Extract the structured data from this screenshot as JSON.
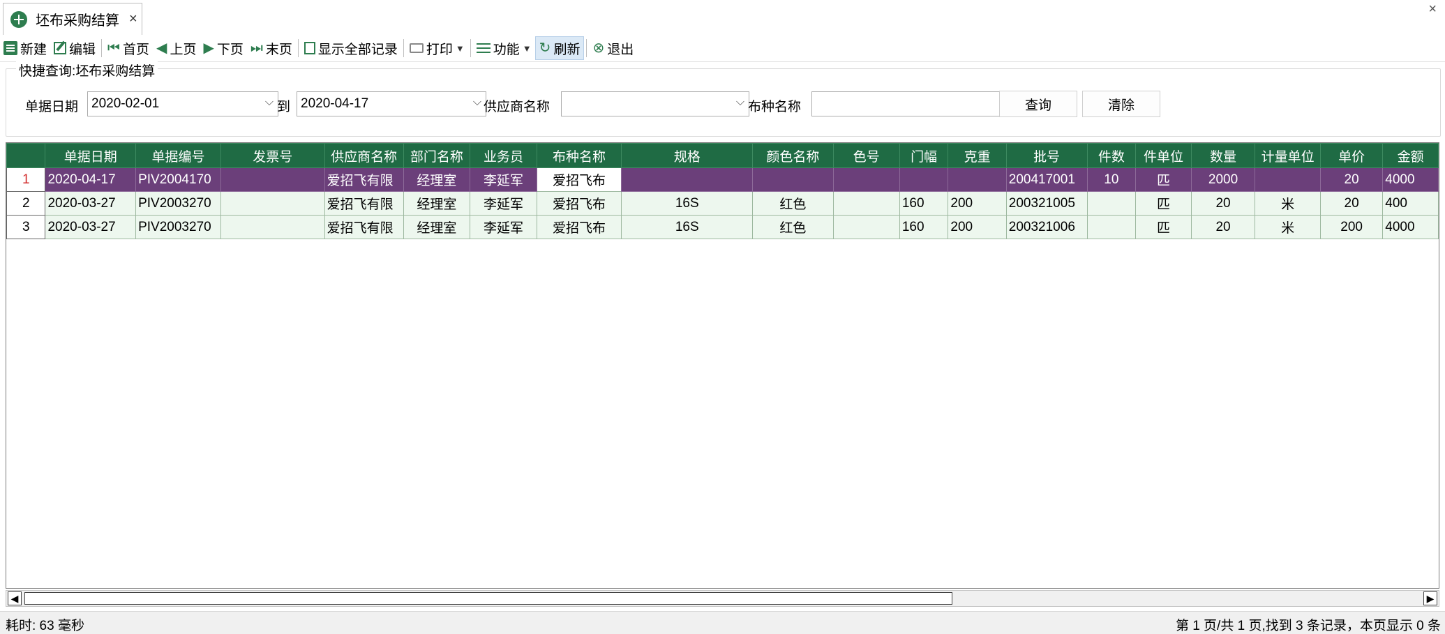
{
  "tab": {
    "title": "坯布采购结算",
    "close": "×"
  },
  "window": {
    "close": "×"
  },
  "toolbar": {
    "new": "新建",
    "edit": "编辑",
    "first": "首页",
    "prev": "上页",
    "next": "下页",
    "last": "末页",
    "show_all": "显示全部记录",
    "print": "打印",
    "function": "功能",
    "refresh": "刷新",
    "exit": "退出"
  },
  "query": {
    "title": "快捷查询:坯布采购结算",
    "date_label": "单据日期",
    "date_from": "2020-02-01",
    "to_label": "到",
    "date_to": "2020-04-17",
    "supplier_label": "供应商名称",
    "supplier_value": "",
    "fabric_label": "布种名称",
    "fabric_value": "",
    "search_button": "查询",
    "clear_button": "清除"
  },
  "grid": {
    "columns": [
      "",
      "单据日期",
      "单据编号",
      "发票号",
      "供应商名称",
      "部门名称",
      "业务员",
      "布种名称",
      "规格",
      "颜色名称",
      "色号",
      "门幅",
      "克重",
      "批号",
      "件数",
      "件单位",
      "数量",
      "计量单位",
      "单价",
      "金额"
    ],
    "rows": [
      [
        "1",
        "2020-04-17",
        "PIV2004170",
        "",
        "爱招飞有限",
        "经理室",
        "李延军",
        "爱招飞布",
        "",
        "",
        "",
        "",
        "",
        "200417001",
        "10",
        "匹",
        "2000",
        "",
        "20",
        "4000"
      ],
      [
        "2",
        "2020-03-27",
        "PIV2003270",
        "",
        "爱招飞有限",
        "经理室",
        "李延军",
        "爱招飞布",
        "16S",
        "红色",
        "",
        "160",
        "200",
        "200321005",
        "",
        "匹",
        "20",
        "米",
        "20",
        "400"
      ],
      [
        "3",
        "2020-03-27",
        "PIV2003270",
        "",
        "爱招飞有限",
        "经理室",
        "李延军",
        "爱招飞布",
        "16S",
        "红色",
        "",
        "160",
        "200",
        "200321006",
        "",
        "匹",
        "20",
        "米",
        "200",
        "4000"
      ]
    ],
    "selected_row": 0
  },
  "status": {
    "elapsed": "耗时: 63 毫秒",
    "paging": "第 1 页/共 1 页,找到 3 条记录，本页显示 0 条"
  },
  "colors": {
    "header_bg": "#1f6b44",
    "selected_row_bg": "#6b3f7a",
    "row_bg": "#edf7ee",
    "icon_green": "#2e7d4f"
  }
}
